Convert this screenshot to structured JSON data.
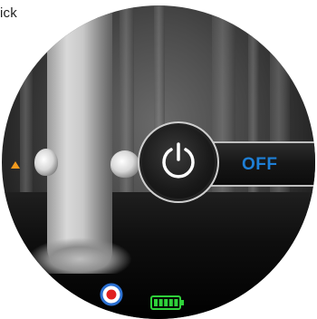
{
  "caption": {
    "text": "ick"
  },
  "power": {
    "state_label": "OFF",
    "state_color": "#1e7fd6"
  },
  "colors": {
    "marker": "#f29a1e",
    "record_ring": "#2a6fd1",
    "record_dot": "#e02020",
    "battery": "#2fd13a"
  },
  "icons": {
    "power": "power-icon",
    "record": "record-icon",
    "battery": "battery-icon",
    "marker": "triangle-marker-icon"
  },
  "battery": {
    "level": 1.0
  }
}
